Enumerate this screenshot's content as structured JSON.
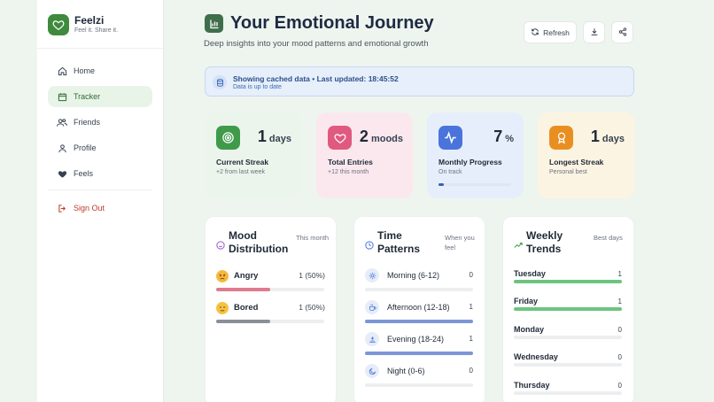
{
  "brand": {
    "name": "Feelzi",
    "tagline": "Feel it. Share it.",
    "logo_icon": "heart-icon",
    "accent": "#3f8a3c"
  },
  "nav": {
    "items": [
      {
        "label": "Home",
        "icon": "home-icon",
        "active": false
      },
      {
        "label": "Tracker",
        "icon": "calendar-icon",
        "active": true
      },
      {
        "label": "Friends",
        "icon": "users-icon",
        "active": false
      },
      {
        "label": "Profile",
        "icon": "user-icon",
        "active": false
      },
      {
        "label": "Feels",
        "icon": "heart-icon",
        "active": false
      }
    ],
    "sign_out": {
      "label": "Sign Out",
      "icon": "logout-icon",
      "color": "#c0392b"
    }
  },
  "header": {
    "title": "Your Emotional Journey",
    "subtitle": "Deep insights into your mood patterns and emotional growth",
    "icon": "bar-chart-icon",
    "refresh_label": "Refresh"
  },
  "banner": {
    "message": "Showing cached data • Last updated: 18:45:52",
    "sub": "Data is up to date",
    "icon": "database-icon"
  },
  "stats": [
    {
      "value": "1",
      "unit": "days",
      "label": "Current Streak",
      "sub": "+2 from last week",
      "icon": "target-icon",
      "color": "#3f9a4a"
    },
    {
      "value": "2",
      "unit": "moods",
      "label": "Total Entries",
      "sub": "+12 this month",
      "icon": "heart-icon",
      "color": "#e0597f"
    },
    {
      "value": "7",
      "unit": "%",
      "label": "Monthly Progress",
      "sub": "On track",
      "icon": "activity-icon",
      "color": "#4a74dc",
      "progress": 0.07
    },
    {
      "value": "1",
      "unit": "days",
      "label": "Longest Streak",
      "sub": "Personal best",
      "icon": "award-icon",
      "color": "#e98f22"
    }
  ],
  "mood_distribution": {
    "title": "Mood Distribution",
    "note": "This month",
    "items": [
      {
        "name": "Angry",
        "count": "1 (50%)",
        "fraction": 0.5,
        "color": "#e07a8e"
      },
      {
        "name": "Bored",
        "count": "1 (50%)",
        "fraction": 0.5,
        "color": "#8a8f98"
      }
    ]
  },
  "time_patterns": {
    "title": "Time Patterns",
    "note": "When you feel",
    "items": [
      {
        "name": "Morning (6-12)",
        "count": "0",
        "fraction": 0,
        "icon": "sun-icon"
      },
      {
        "name": "Afternoon (12-18)",
        "count": "1",
        "fraction": 1,
        "icon": "coffee-icon"
      },
      {
        "name": "Evening (18-24)",
        "count": "1",
        "fraction": 1,
        "icon": "sunset-icon"
      },
      {
        "name": "Night (0-6)",
        "count": "0",
        "fraction": 0,
        "icon": "moon-icon"
      }
    ],
    "bar_color": "#7c96d8"
  },
  "weekly_trends": {
    "title": "Weekly Trends",
    "note": "Best days",
    "items": [
      {
        "name": "Tuesday",
        "count": "1",
        "fraction": 1
      },
      {
        "name": "Friday",
        "count": "1",
        "fraction": 1
      },
      {
        "name": "Monday",
        "count": "0",
        "fraction": 0
      },
      {
        "name": "Wednesday",
        "count": "0",
        "fraction": 0
      },
      {
        "name": "Thursday",
        "count": "0",
        "fraction": 0
      }
    ],
    "bar_color": "#6cc47f"
  }
}
